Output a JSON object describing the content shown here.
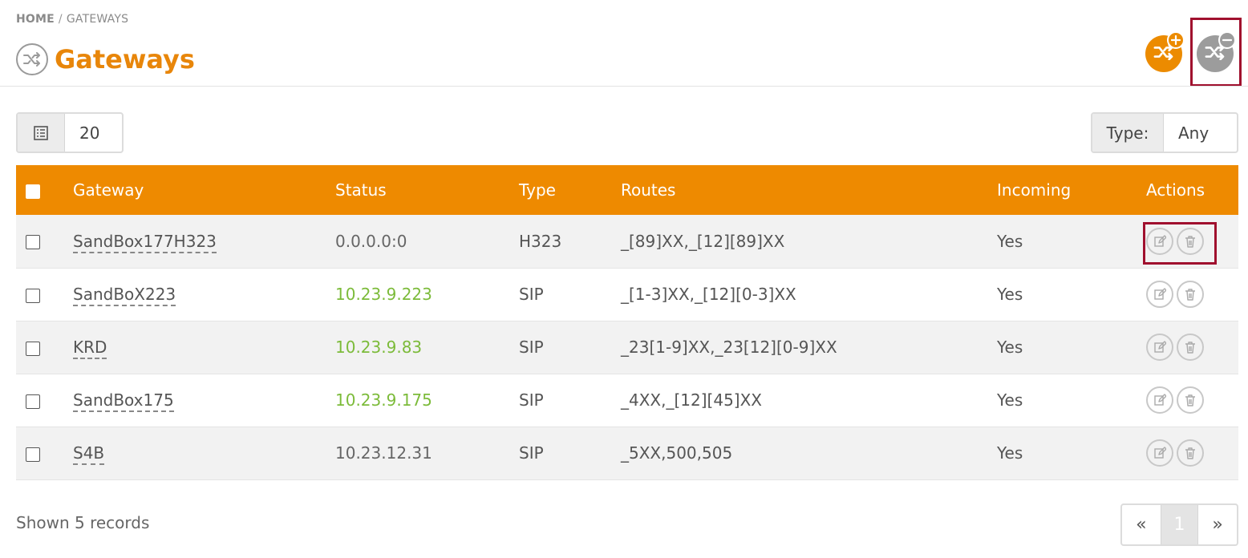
{
  "breadcrumb": {
    "home": "HOME",
    "separator": "/",
    "current": "GATEWAYS"
  },
  "page": {
    "title": "Gateways",
    "title_icon": "shuffle-icon"
  },
  "toolbar": {
    "add_icon": "shuffle-add-icon",
    "remove_icon": "shuffle-remove-icon"
  },
  "page_size": {
    "value": "20",
    "icon": "list-icon"
  },
  "type_filter": {
    "label": "Type:",
    "value": "Any"
  },
  "table": {
    "headers": [
      "Gateway",
      "Status",
      "Type",
      "Routes",
      "Incoming",
      "Actions"
    ],
    "rows": [
      {
        "gateway": "SandBox177H323",
        "status": "0.0.0.0:0",
        "status_kind": "default",
        "type": "H323",
        "routes": "_[89]XX,_[12][89]XX",
        "incoming": "Yes"
      },
      {
        "gateway": "SandBoX223",
        "status": "10.23.9.223",
        "status_kind": "ok",
        "type": "SIP",
        "routes": "_[1-3]XX,_[12][0-3]XX",
        "incoming": "Yes"
      },
      {
        "gateway": "KRD",
        "status": "10.23.9.83",
        "status_kind": "ok",
        "type": "SIP",
        "routes": "_23[1-9]XX,_23[12][0-9]XX",
        "incoming": "Yes"
      },
      {
        "gateway": "SandBox175",
        "status": "10.23.9.175",
        "status_kind": "ok",
        "type": "SIP",
        "routes": "_4XX,_[12][45]XX",
        "incoming": "Yes"
      },
      {
        "gateway": "S4B",
        "status": "10.23.12.31",
        "status_kind": "default",
        "type": "SIP",
        "routes": "_5XX,500,505",
        "incoming": "Yes"
      }
    ]
  },
  "footer": {
    "records": "Shown 5 records"
  },
  "pagination": {
    "prev": "«",
    "current": "1",
    "next": "»"
  },
  "colors": {
    "accent": "#ee8a00",
    "status_ok": "#7cbb3a",
    "highlight": "#a0102e"
  }
}
